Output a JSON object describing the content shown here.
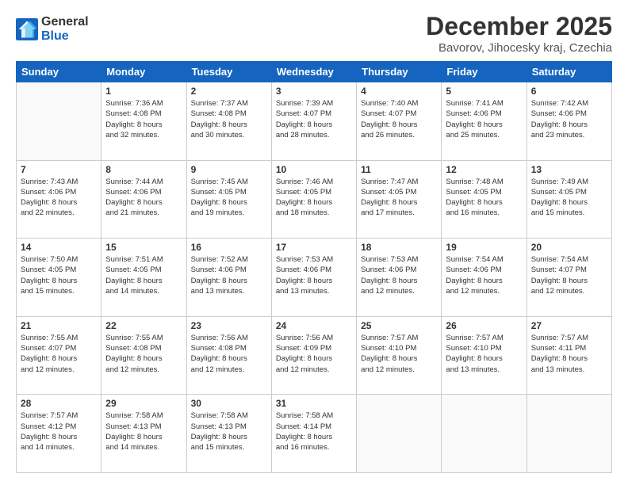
{
  "header": {
    "logo_line1": "General",
    "logo_line2": "Blue",
    "month_title": "December 2025",
    "location": "Bavorov, Jihocesky kraj, Czechia"
  },
  "weekdays": [
    "Sunday",
    "Monday",
    "Tuesday",
    "Wednesday",
    "Thursday",
    "Friday",
    "Saturday"
  ],
  "weeks": [
    [
      {
        "day": "",
        "content": ""
      },
      {
        "day": "1",
        "content": "Sunrise: 7:36 AM\nSunset: 4:08 PM\nDaylight: 8 hours\nand 32 minutes."
      },
      {
        "day": "2",
        "content": "Sunrise: 7:37 AM\nSunset: 4:08 PM\nDaylight: 8 hours\nand 30 minutes."
      },
      {
        "day": "3",
        "content": "Sunrise: 7:39 AM\nSunset: 4:07 PM\nDaylight: 8 hours\nand 28 minutes."
      },
      {
        "day": "4",
        "content": "Sunrise: 7:40 AM\nSunset: 4:07 PM\nDaylight: 8 hours\nand 26 minutes."
      },
      {
        "day": "5",
        "content": "Sunrise: 7:41 AM\nSunset: 4:06 PM\nDaylight: 8 hours\nand 25 minutes."
      },
      {
        "day": "6",
        "content": "Sunrise: 7:42 AM\nSunset: 4:06 PM\nDaylight: 8 hours\nand 23 minutes."
      }
    ],
    [
      {
        "day": "7",
        "content": "Sunrise: 7:43 AM\nSunset: 4:06 PM\nDaylight: 8 hours\nand 22 minutes."
      },
      {
        "day": "8",
        "content": "Sunrise: 7:44 AM\nSunset: 4:06 PM\nDaylight: 8 hours\nand 21 minutes."
      },
      {
        "day": "9",
        "content": "Sunrise: 7:45 AM\nSunset: 4:05 PM\nDaylight: 8 hours\nand 19 minutes."
      },
      {
        "day": "10",
        "content": "Sunrise: 7:46 AM\nSunset: 4:05 PM\nDaylight: 8 hours\nand 18 minutes."
      },
      {
        "day": "11",
        "content": "Sunrise: 7:47 AM\nSunset: 4:05 PM\nDaylight: 8 hours\nand 17 minutes."
      },
      {
        "day": "12",
        "content": "Sunrise: 7:48 AM\nSunset: 4:05 PM\nDaylight: 8 hours\nand 16 minutes."
      },
      {
        "day": "13",
        "content": "Sunrise: 7:49 AM\nSunset: 4:05 PM\nDaylight: 8 hours\nand 15 minutes."
      }
    ],
    [
      {
        "day": "14",
        "content": "Sunrise: 7:50 AM\nSunset: 4:05 PM\nDaylight: 8 hours\nand 15 minutes."
      },
      {
        "day": "15",
        "content": "Sunrise: 7:51 AM\nSunset: 4:05 PM\nDaylight: 8 hours\nand 14 minutes."
      },
      {
        "day": "16",
        "content": "Sunrise: 7:52 AM\nSunset: 4:06 PM\nDaylight: 8 hours\nand 13 minutes."
      },
      {
        "day": "17",
        "content": "Sunrise: 7:53 AM\nSunset: 4:06 PM\nDaylight: 8 hours\nand 13 minutes."
      },
      {
        "day": "18",
        "content": "Sunrise: 7:53 AM\nSunset: 4:06 PM\nDaylight: 8 hours\nand 12 minutes."
      },
      {
        "day": "19",
        "content": "Sunrise: 7:54 AM\nSunset: 4:06 PM\nDaylight: 8 hours\nand 12 minutes."
      },
      {
        "day": "20",
        "content": "Sunrise: 7:54 AM\nSunset: 4:07 PM\nDaylight: 8 hours\nand 12 minutes."
      }
    ],
    [
      {
        "day": "21",
        "content": "Sunrise: 7:55 AM\nSunset: 4:07 PM\nDaylight: 8 hours\nand 12 minutes."
      },
      {
        "day": "22",
        "content": "Sunrise: 7:55 AM\nSunset: 4:08 PM\nDaylight: 8 hours\nand 12 minutes."
      },
      {
        "day": "23",
        "content": "Sunrise: 7:56 AM\nSunset: 4:08 PM\nDaylight: 8 hours\nand 12 minutes."
      },
      {
        "day": "24",
        "content": "Sunrise: 7:56 AM\nSunset: 4:09 PM\nDaylight: 8 hours\nand 12 minutes."
      },
      {
        "day": "25",
        "content": "Sunrise: 7:57 AM\nSunset: 4:10 PM\nDaylight: 8 hours\nand 12 minutes."
      },
      {
        "day": "26",
        "content": "Sunrise: 7:57 AM\nSunset: 4:10 PM\nDaylight: 8 hours\nand 13 minutes."
      },
      {
        "day": "27",
        "content": "Sunrise: 7:57 AM\nSunset: 4:11 PM\nDaylight: 8 hours\nand 13 minutes."
      }
    ],
    [
      {
        "day": "28",
        "content": "Sunrise: 7:57 AM\nSunset: 4:12 PM\nDaylight: 8 hours\nand 14 minutes."
      },
      {
        "day": "29",
        "content": "Sunrise: 7:58 AM\nSunset: 4:13 PM\nDaylight: 8 hours\nand 14 minutes."
      },
      {
        "day": "30",
        "content": "Sunrise: 7:58 AM\nSunset: 4:13 PM\nDaylight: 8 hours\nand 15 minutes."
      },
      {
        "day": "31",
        "content": "Sunrise: 7:58 AM\nSunset: 4:14 PM\nDaylight: 8 hours\nand 16 minutes."
      },
      {
        "day": "",
        "content": ""
      },
      {
        "day": "",
        "content": ""
      },
      {
        "day": "",
        "content": ""
      }
    ]
  ]
}
